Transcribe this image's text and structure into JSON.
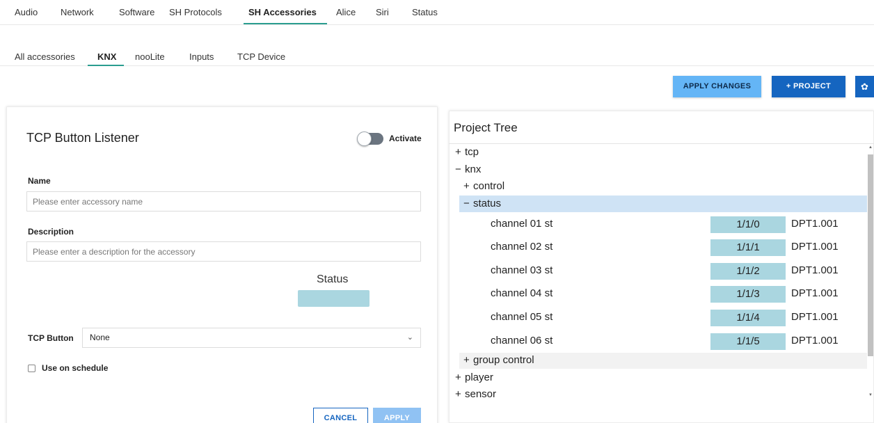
{
  "top_tabs": [
    "Audio",
    "Network",
    "Software",
    "SH Protocols",
    "SH Accessories",
    "Alice",
    "Siri",
    "Status"
  ],
  "sub_tabs": [
    "All accessories",
    "KNX",
    "nooLite",
    "Inputs",
    "TCP Device"
  ],
  "toolbar": {
    "apply_changes": "APPLY CHANGES",
    "project": "+ PROJECT",
    "gear_icon": "gear-icon"
  },
  "form": {
    "title": "TCP Button Listener",
    "activate_label": "Activate",
    "name_label": "Name",
    "name_placeholder": "Please enter accessory name",
    "description_label": "Description",
    "description_placeholder": "Please enter a description for the accessory",
    "status_label": "Status",
    "tcp_button_label": "TCP Button",
    "tcp_button_value": "None",
    "schedule_label": "Use on schedule",
    "cancel": "CANCEL",
    "apply": "APPLY"
  },
  "tree": {
    "title": "Project Tree",
    "nodes": {
      "tcp": "tcp",
      "knx": "knx",
      "control": "control",
      "status": "status",
      "group_control": "group control",
      "player": "player",
      "sensor": "sensor"
    },
    "signs": {
      "plus": "+",
      "minus": "−"
    },
    "channels": [
      {
        "name": "channel 01 st",
        "address": "1/1/0",
        "dpt": "DPT1.001"
      },
      {
        "name": "channel 02 st",
        "address": "1/1/1",
        "dpt": "DPT1.001"
      },
      {
        "name": "channel 03 st",
        "address": "1/1/2",
        "dpt": "DPT1.001"
      },
      {
        "name": "channel 04 st",
        "address": "1/1/3",
        "dpt": "DPT1.001"
      },
      {
        "name": "channel 05 st",
        "address": "1/1/4",
        "dpt": "DPT1.001"
      },
      {
        "name": "channel 06 st",
        "address": "1/1/5",
        "dpt": "DPT1.001"
      }
    ]
  },
  "colors": {
    "accent_teal": "#2a9d8f",
    "primary_blue": "#1565c0",
    "light_blue": "#64b5f6",
    "address_bg": "#aad6e0",
    "selected_row": "#cfe3f5"
  }
}
